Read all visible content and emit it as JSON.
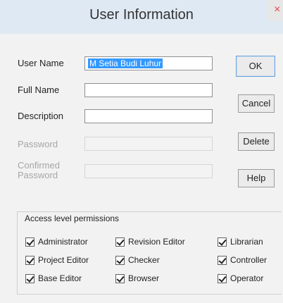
{
  "window": {
    "title": "User Information",
    "close_glyph": "×"
  },
  "form": {
    "user_name_label": "User Name",
    "user_name_value": "M Setia Budi Luhur",
    "full_name_label": "Full Name",
    "full_name_value": "",
    "description_label": "Description",
    "description_value": "",
    "password_label": "Password",
    "confirmed_label_line1": "Confirmed",
    "confirmed_label_line2": "Password"
  },
  "buttons": {
    "ok": "OK",
    "cancel": "Cancel",
    "delete": "Delete",
    "help": "Help"
  },
  "permissions": {
    "legend": "Access level permissions",
    "items": [
      {
        "label": "Administrator",
        "checked": true
      },
      {
        "label": "Revision Editor",
        "checked": true
      },
      {
        "label": "Librarian",
        "checked": true
      },
      {
        "label": "Project Editor",
        "checked": true
      },
      {
        "label": "Checker",
        "checked": true
      },
      {
        "label": "Controller",
        "checked": true
      },
      {
        "label": "Base Editor",
        "checked": true
      },
      {
        "label": "Browser",
        "checked": true
      },
      {
        "label": "Operator",
        "checked": true
      }
    ]
  },
  "colors": {
    "titlebar": "#dfe9f4",
    "selection": "#3399ff",
    "close_x": "#e5494b"
  },
  "icons": {
    "close": "close-icon",
    "checkbox": "checkmark-icon"
  }
}
